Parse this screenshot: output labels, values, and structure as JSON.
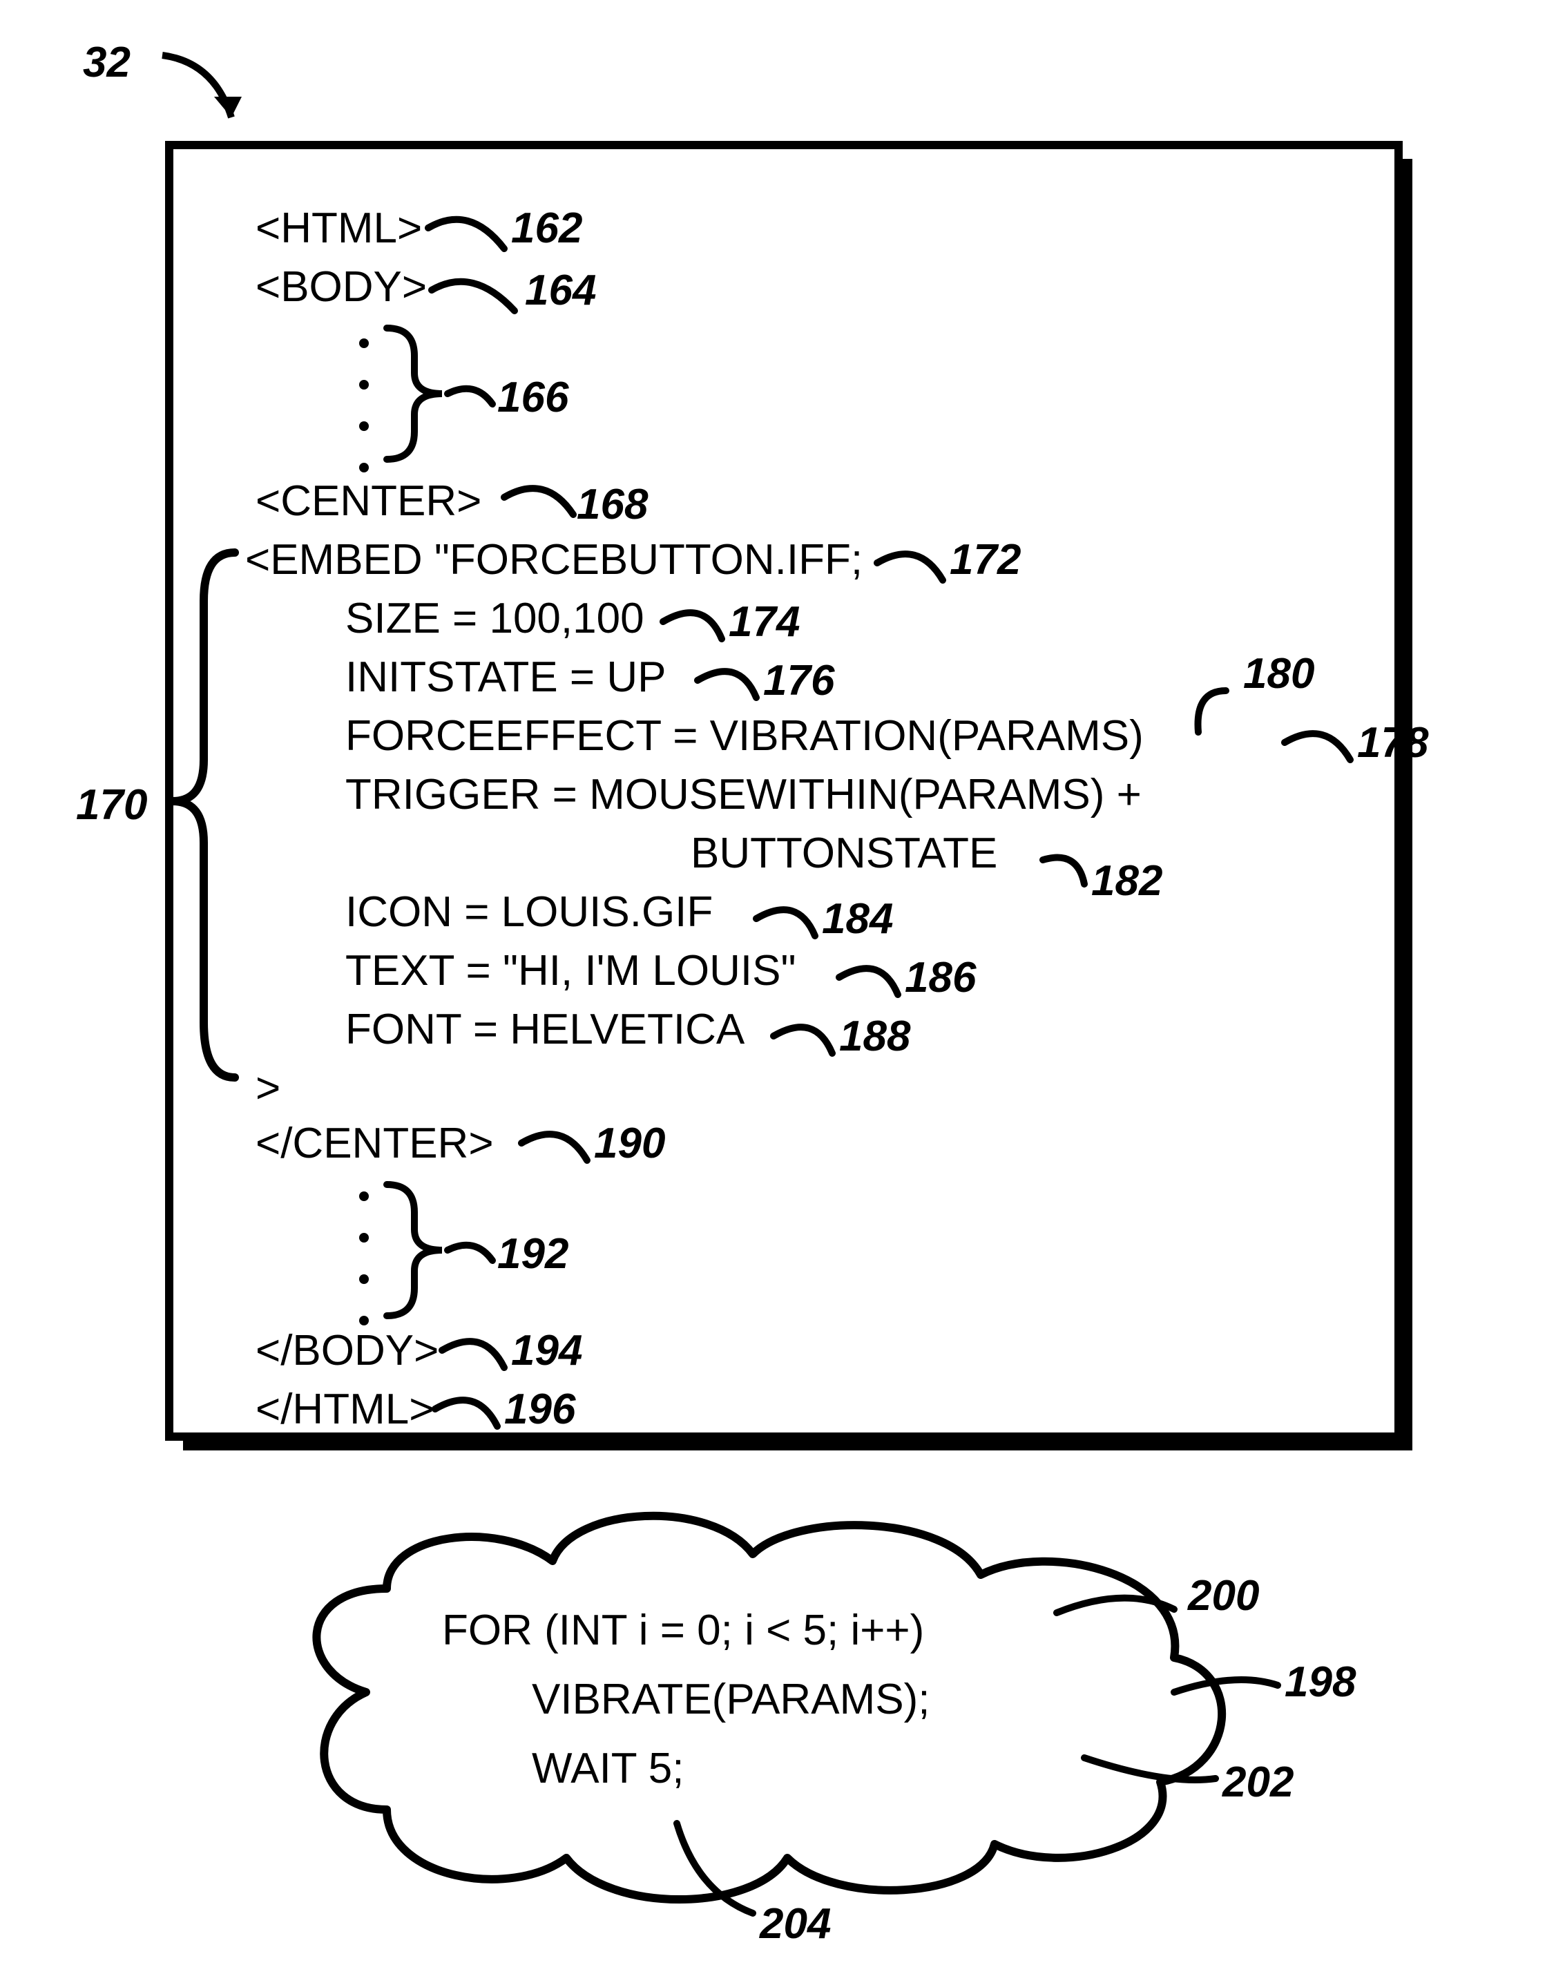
{
  "figure_ref": "32",
  "code_box": {
    "lines": {
      "l162": "<HTML>",
      "l164": "<BODY>",
      "l168": "<CENTER>",
      "l172": "<EMBED \"FORCEBUTTON.IFF;",
      "l174": "SIZE = 100,100",
      "l176": "INITSTATE = UP",
      "l178": "FORCEEFFECT = VIBRATION(PARAMS)",
      "l180a": "TRIGGER = MOUSEWITHIN(PARAMS) +",
      "l180b": "BUTTONSTATE",
      "l184": "ICON = LOUIS.GIF",
      "l186": "TEXT = \"HI, I'M LOUIS\"",
      "l188": "FONT = HELVETICA",
      "close_embed": ">",
      "l190": "</CENTER>",
      "l194": "</BODY>",
      "l196": "</HTML>"
    }
  },
  "cloud": {
    "l200": "FOR (INT i = 0; i < 5; i++)",
    "l202": "VIBRATE(PARAMS);",
    "l204": "WAIT 5;"
  },
  "callouts": {
    "c162": "162",
    "c164": "164",
    "c166": "166",
    "c168": "168",
    "c170": "170",
    "c172": "172",
    "c174": "174",
    "c176": "176",
    "c178": "178",
    "c180": "180",
    "c182": "182",
    "c184": "184",
    "c186": "186",
    "c188": "188",
    "c190": "190",
    "c192": "192",
    "c194": "194",
    "c196": "196",
    "c198": "198",
    "c200": "200",
    "c202": "202",
    "c204": "204"
  }
}
